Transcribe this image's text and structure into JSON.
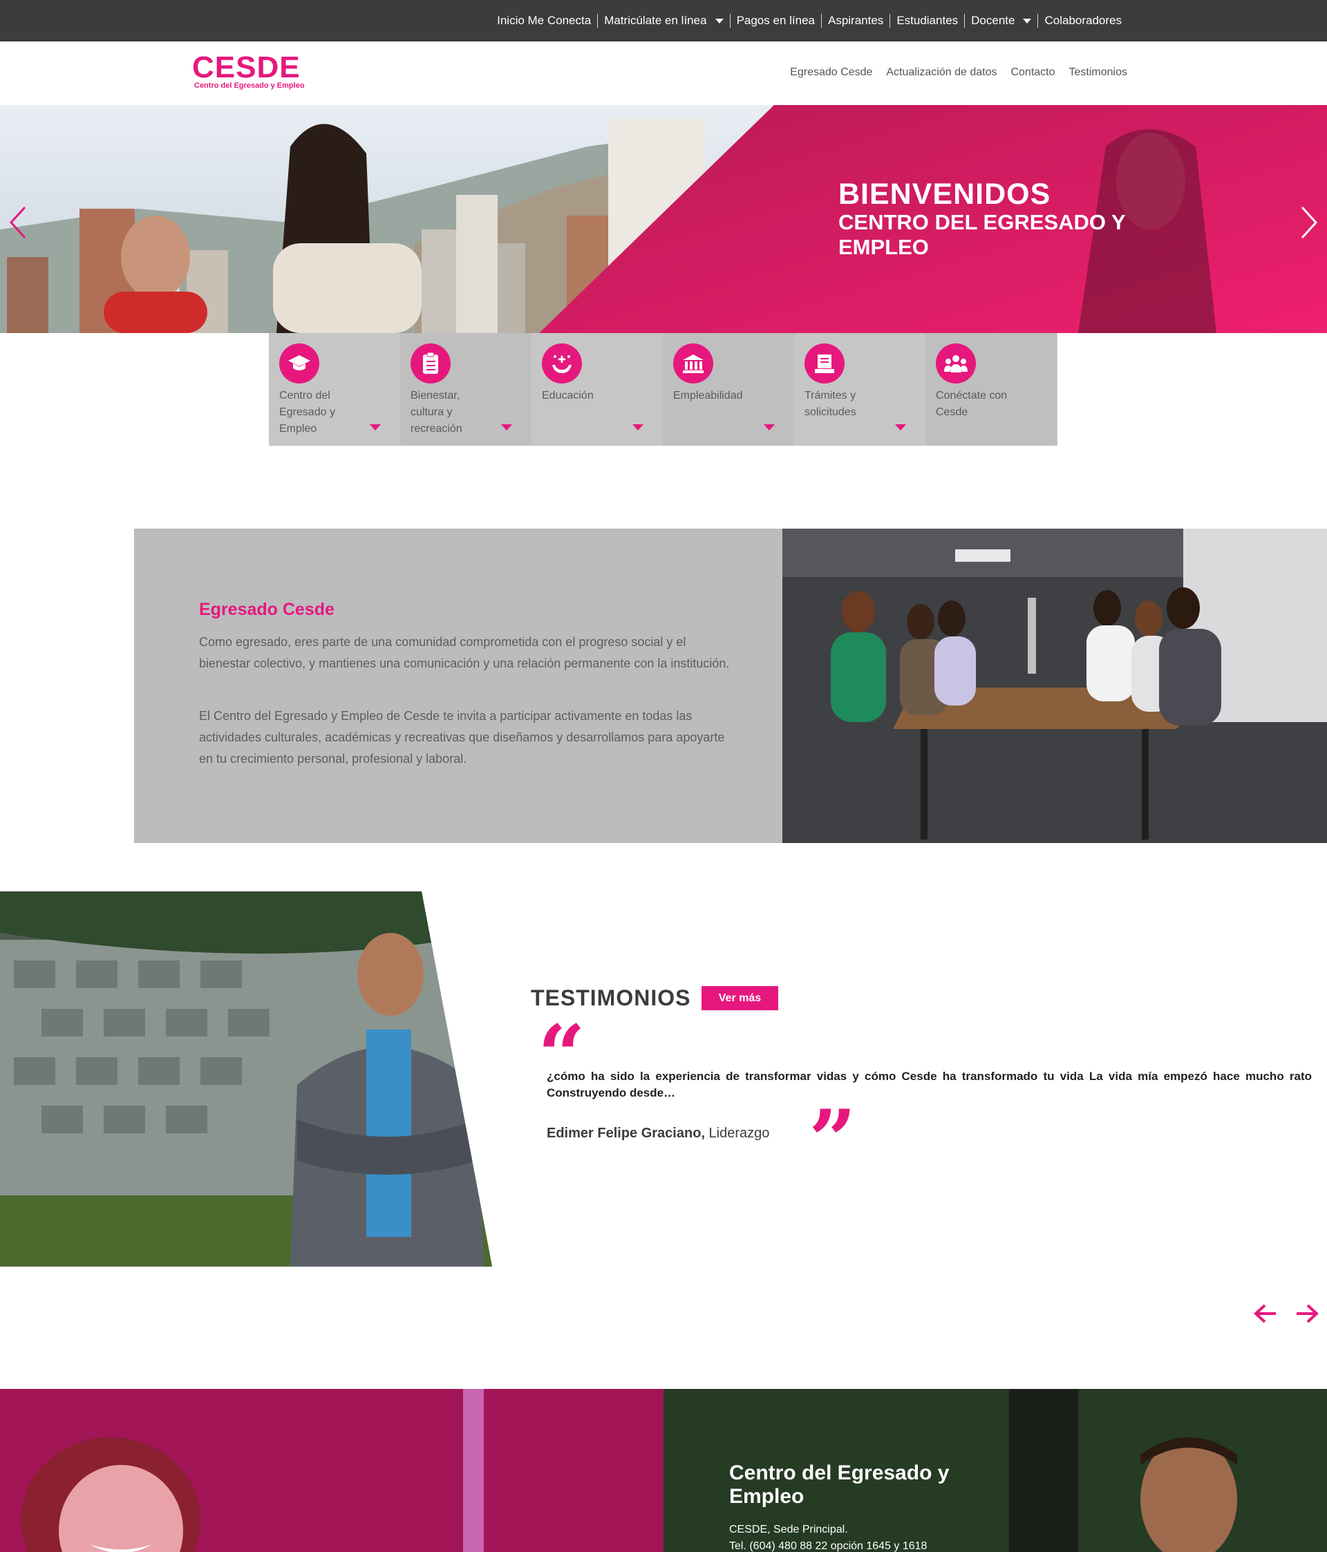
{
  "topbar": {
    "items": [
      {
        "label": "Inicio Me Conecta",
        "dropdown": false
      },
      {
        "label": "Matricúlate en línea",
        "dropdown": true
      },
      {
        "label": "Pagos en línea",
        "dropdown": false
      },
      {
        "label": "Aspirantes",
        "dropdown": false
      },
      {
        "label": "Estudiantes",
        "dropdown": false
      },
      {
        "label": "Docente",
        "dropdown": true
      },
      {
        "label": "Colaboradores",
        "dropdown": false
      }
    ]
  },
  "header": {
    "logo_text": "CESDE",
    "logo_sub": "Centro del Egresado y Empleo",
    "nav": [
      "Egresado Cesde",
      "Actualización de datos",
      "Contacto",
      "Testimonios"
    ]
  },
  "hero": {
    "title": "BIENVENIDOS",
    "subtitle": "CENTRO DEL EGRESADO Y EMPLEO",
    "prev_icon": "chevron-left-icon",
    "next_icon": "chevron-right-icon"
  },
  "tiles": [
    {
      "label": "Centro del Egresado y Empleo",
      "icon": "graduation-cap-icon",
      "dropdown": true
    },
    {
      "label": "Bienestar, cultura y recreación",
      "icon": "clipboard-icon",
      "dropdown": true
    },
    {
      "label": "Educación",
      "icon": "hands-sparkle-icon",
      "dropdown": true
    },
    {
      "label": "Empleabilidad",
      "icon": "building-icon",
      "dropdown": true
    },
    {
      "label": "Trámites y solicitudes",
      "icon": "document-icon",
      "dropdown": true
    },
    {
      "label": "Conéctate con Cesde",
      "icon": "people-group-icon",
      "dropdown": false
    }
  ],
  "about": {
    "title": "Egresado Cesde",
    "p1": "Como egresado, eres parte de una comunidad comprometida con el progreso social y el bienestar colectivo, y mantienes una comunicación y una relación permanente con la institución.",
    "p2": "El Centro del Egresado y Empleo de Cesde te invita a participar activamente en todas las actividades culturales, académicas y recreativas que diseñamos y desarrollamos para apoyarte en tu crecimiento personal, profesional y laboral."
  },
  "testimonials": {
    "title": "TESTIMONIOS",
    "more_label": "Ver más",
    "quote": "¿cómo ha sido la experiencia de transformar vidas y cómo Cesde ha transformado tu vida La vida mía empezó hace mucho rato Construyendo desde…",
    "author_name": "Edimer Felipe Graciano,",
    "author_role": "Liderazgo",
    "quote_open": "“",
    "quote_close": "”"
  },
  "footer_band": {
    "title": "Centro del Egresado y Empleo",
    "line1": "CESDE, Sede Principal.",
    "line2": "Tel. (604) 480 88 22 opción 1645 y 1618"
  },
  "colors": {
    "accent": "#e6187d",
    "topbar": "#3c3c3c",
    "tile_bg": "#c6c6c6",
    "about_bg": "#bcbcbf"
  }
}
